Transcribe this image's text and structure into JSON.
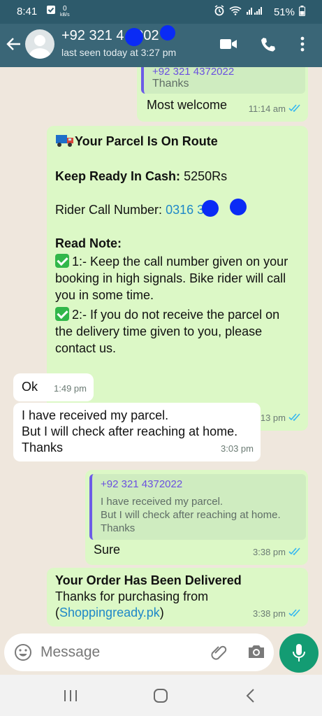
{
  "status_bar": {
    "time": "8:41",
    "speed_top": "0",
    "speed_unit": "kB/s",
    "battery": "51%"
  },
  "header": {
    "contact_name": "+92 321 4  7202",
    "contact_status": "last seen today at 3:27 pm"
  },
  "messages": {
    "m1": {
      "quote_name": "+92 321 4372022",
      "quote_text": "Thanks",
      "text": "Most welcome",
      "time": "11:14 am"
    },
    "m2": {
      "title": "Your Parcel Is On Route",
      "cash_label": "Keep Ready In Cash:",
      "cash_value": "5250Rs",
      "rider_label": "Rider Call Number:",
      "rider_number": "0316    3   0",
      "note_title": "Read Note:",
      "note1": "1:- Keep the call number given on your booking in high signals. Bike rider will call you in some time.",
      "note2": "2:- If you do not receive the parcel on the delivery time given to you, please contact us.",
      "time": "1:13 pm"
    },
    "m3": {
      "text": "Ok",
      "time": "1:49 pm"
    },
    "m4": {
      "line1": "I have received my parcel.",
      "line2": "But I will check after reaching at home.",
      "line3": "Thanks",
      "time": "3:03 pm"
    },
    "m5": {
      "quote_name": "+92 321 4372022",
      "q1": "I have received my parcel.",
      "q2": "But I will check after reaching at home.",
      "q3": "Thanks",
      "text": "Sure",
      "time": "3:38 pm"
    },
    "m6": {
      "title": "Your Order Has Been Delivered",
      "line1": "Thanks for purchasing from",
      "paren_open": "(",
      "link": "Shoppingready.pk",
      "paren_close": ")",
      "time": "3:38 pm"
    }
  },
  "composer": {
    "placeholder": "Message"
  },
  "colors": {
    "header": "#3a6677",
    "status_bar": "#2d5a6b",
    "outgoing": "#dcf8c6",
    "incoming": "#ffffff",
    "mic": "#139c73",
    "read_ticks": "#34b7f1",
    "chat_bg": "#efe7dd"
  }
}
